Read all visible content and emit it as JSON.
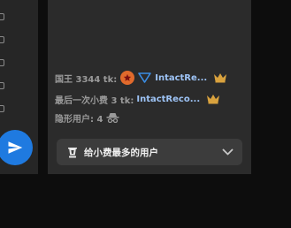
{
  "colors": {
    "background": "#0d0d0d",
    "panel": "#2b2b2b",
    "accent": "#1f7ae0",
    "username": "#9dc3f5",
    "crown": "#d9a23e"
  },
  "tipping": {
    "king": {
      "label": "国王 3344 tk:",
      "username": "IntactRe...",
      "icons": [
        "star-badge-icon",
        "v-badge-icon",
        "crown-icon"
      ]
    },
    "last_tip": {
      "label": "最后一次小费 3 tk:",
      "username": "IntactReco...",
      "icons": [
        "crown-icon"
      ]
    },
    "hidden_users": {
      "label": "隐形用户: 4",
      "icons": [
        "incognito-icon"
      ]
    },
    "top_tippers_dropdown": {
      "label": "给小费最多的用户",
      "icons": [
        "trophy-icon",
        "chevron-down-icon"
      ]
    }
  },
  "sidebar": {
    "icons": [
      "send-icon"
    ]
  }
}
